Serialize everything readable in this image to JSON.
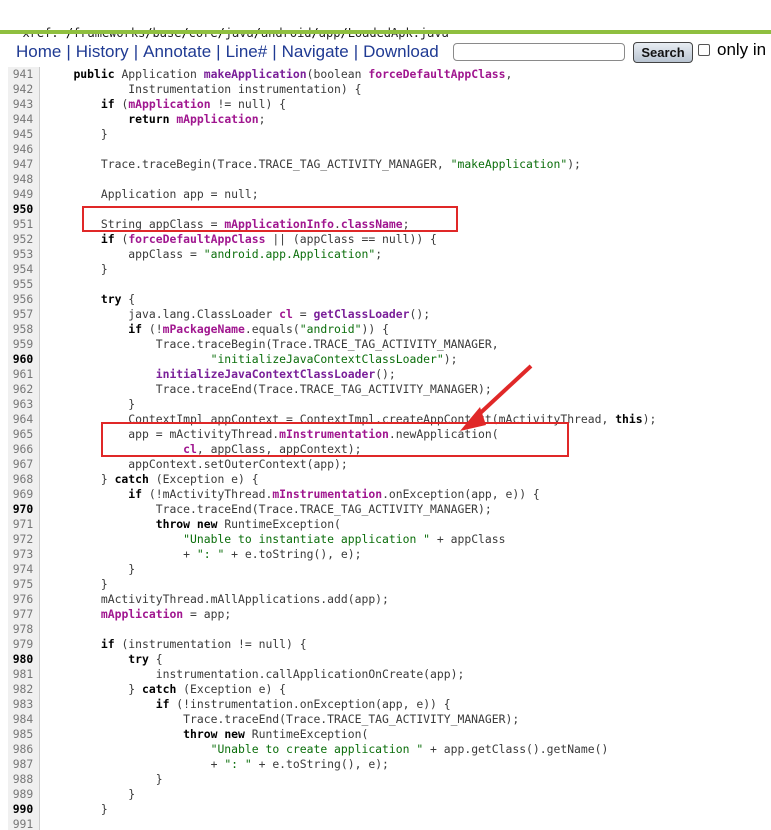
{
  "breadcrumb": {
    "prefix": "xref:",
    "parts": [
      "frameworks",
      "base",
      "core",
      "java",
      "android",
      "app",
      "LoadedApk.java"
    ]
  },
  "nav": {
    "items": [
      "Home",
      "History",
      "Annotate",
      "Line#",
      "Navigate",
      "Download"
    ]
  },
  "search": {
    "value": "",
    "button_label": "Search",
    "only_label": "only in"
  },
  "code": {
    "lines": [
      {
        "n": "941",
        "bold": false,
        "t": [
          [
            "    ",
            ""
          ],
          [
            "public",
            "kw"
          ],
          [
            " Application ",
            ""
          ],
          [
            "makeApplication",
            "fn"
          ],
          [
            "(boolean ",
            ""
          ],
          [
            "forceDefaultAppClass",
            "fld"
          ],
          [
            ",",
            ""
          ]
        ]
      },
      {
        "n": "942",
        "bold": false,
        "t": [
          [
            "            Instrumentation instrumentation) {",
            ""
          ]
        ]
      },
      {
        "n": "943",
        "bold": false,
        "t": [
          [
            "        ",
            ""
          ],
          [
            "if",
            "kw"
          ],
          [
            " (",
            ""
          ],
          [
            "mApplication",
            "fld"
          ],
          [
            " != null) {",
            ""
          ]
        ]
      },
      {
        "n": "944",
        "bold": false,
        "t": [
          [
            "            ",
            ""
          ],
          [
            "return",
            "kw"
          ],
          [
            " ",
            ""
          ],
          [
            "mApplication",
            "fld"
          ],
          [
            ";",
            ""
          ]
        ]
      },
      {
        "n": "945",
        "bold": false,
        "t": [
          [
            "        }",
            ""
          ]
        ]
      },
      {
        "n": "946",
        "bold": false,
        "t": [
          [
            "",
            ""
          ]
        ]
      },
      {
        "n": "947",
        "bold": false,
        "t": [
          [
            "        Trace.traceBegin(Trace.TRACE_TAG_ACTIVITY_MANAGER, ",
            ""
          ],
          [
            "\"makeApplication\"",
            "str"
          ],
          [
            ");",
            ""
          ]
        ]
      },
      {
        "n": "948",
        "bold": false,
        "t": [
          [
            "",
            ""
          ]
        ]
      },
      {
        "n": "949",
        "bold": false,
        "t": [
          [
            "        Application app = null;",
            ""
          ]
        ]
      },
      {
        "n": "950",
        "bold": true,
        "t": [
          [
            "",
            ""
          ]
        ]
      },
      {
        "n": "951",
        "bold": false,
        "t": [
          [
            "        String appClass = ",
            ""
          ],
          [
            "mApplicationInfo",
            "fld"
          ],
          [
            ".",
            ""
          ],
          [
            "className",
            "fld"
          ],
          [
            ";",
            ""
          ]
        ]
      },
      {
        "n": "952",
        "bold": false,
        "t": [
          [
            "        ",
            ""
          ],
          [
            "if",
            "kw"
          ],
          [
            " (",
            ""
          ],
          [
            "forceDefaultAppClass",
            "fld"
          ],
          [
            " || (appClass == null)) {",
            ""
          ]
        ]
      },
      {
        "n": "953",
        "bold": false,
        "t": [
          [
            "            appClass = ",
            ""
          ],
          [
            "\"android.app.Application\"",
            "str"
          ],
          [
            ";",
            ""
          ]
        ]
      },
      {
        "n": "954",
        "bold": false,
        "t": [
          [
            "        }",
            ""
          ]
        ]
      },
      {
        "n": "955",
        "bold": false,
        "t": [
          [
            "",
            ""
          ]
        ]
      },
      {
        "n": "956",
        "bold": false,
        "t": [
          [
            "        ",
            ""
          ],
          [
            "try",
            "kw"
          ],
          [
            " {",
            ""
          ]
        ]
      },
      {
        "n": "957",
        "bold": false,
        "t": [
          [
            "            java.lang.ClassLoader ",
            ""
          ],
          [
            "cl",
            "fld"
          ],
          [
            " = ",
            ""
          ],
          [
            "getClassLoader",
            "fn"
          ],
          [
            "();",
            ""
          ]
        ]
      },
      {
        "n": "958",
        "bold": false,
        "t": [
          [
            "            ",
            ""
          ],
          [
            "if",
            "kw"
          ],
          [
            " (!",
            ""
          ],
          [
            "mPackageName",
            "fld"
          ],
          [
            ".equals(",
            ""
          ],
          [
            "\"android\"",
            "str"
          ],
          [
            ")) {",
            ""
          ]
        ]
      },
      {
        "n": "959",
        "bold": false,
        "t": [
          [
            "                Trace.traceBegin(Trace.TRACE_TAG_ACTIVITY_MANAGER,",
            ""
          ]
        ]
      },
      {
        "n": "960",
        "bold": true,
        "t": [
          [
            "                        ",
            ""
          ],
          [
            "\"initializeJavaContextClassLoader\"",
            "str"
          ],
          [
            ");",
            ""
          ]
        ]
      },
      {
        "n": "961",
        "bold": false,
        "t": [
          [
            "                ",
            ""
          ],
          [
            "initializeJavaContextClassLoader",
            "fn"
          ],
          [
            "();",
            ""
          ]
        ]
      },
      {
        "n": "962",
        "bold": false,
        "t": [
          [
            "                Trace.traceEnd(Trace.TRACE_TAG_ACTIVITY_MANAGER);",
            ""
          ]
        ]
      },
      {
        "n": "963",
        "bold": false,
        "t": [
          [
            "            }",
            ""
          ]
        ]
      },
      {
        "n": "964",
        "bold": false,
        "t": [
          [
            "            ContextImpl appContext = ContextImpl.createAppContext(mActivityThread, ",
            ""
          ],
          [
            "this",
            "kw"
          ],
          [
            ");",
            ""
          ]
        ]
      },
      {
        "n": "965",
        "bold": false,
        "t": [
          [
            "            app = mActivityThread.",
            ""
          ],
          [
            "mInstrumentation",
            "fld"
          ],
          [
            ".newApplication(",
            ""
          ]
        ]
      },
      {
        "n": "966",
        "bold": false,
        "t": [
          [
            "                    ",
            ""
          ],
          [
            "cl",
            "fld"
          ],
          [
            ", appClass, appContext);",
            ""
          ]
        ]
      },
      {
        "n": "967",
        "bold": false,
        "t": [
          [
            "            appContext.setOuterContext(app);",
            ""
          ]
        ]
      },
      {
        "n": "968",
        "bold": false,
        "t": [
          [
            "        } ",
            ""
          ],
          [
            "catch",
            "kw"
          ],
          [
            " (Exception e) {",
            ""
          ]
        ]
      },
      {
        "n": "969",
        "bold": false,
        "t": [
          [
            "            ",
            ""
          ],
          [
            "if",
            "kw"
          ],
          [
            " (!mActivityThread.",
            ""
          ],
          [
            "mInstrumentation",
            "fld"
          ],
          [
            ".onException(app, e)) {",
            ""
          ]
        ]
      },
      {
        "n": "970",
        "bold": true,
        "t": [
          [
            "                Trace.traceEnd(Trace.TRACE_TAG_ACTIVITY_MANAGER);",
            ""
          ]
        ]
      },
      {
        "n": "971",
        "bold": false,
        "t": [
          [
            "                ",
            ""
          ],
          [
            "throw",
            "kw"
          ],
          [
            " ",
            ""
          ],
          [
            "new",
            "kw"
          ],
          [
            " RuntimeException(",
            ""
          ]
        ]
      },
      {
        "n": "972",
        "bold": false,
        "t": [
          [
            "                    ",
            ""
          ],
          [
            "\"Unable to instantiate application \"",
            "str"
          ],
          [
            " + appClass",
            ""
          ]
        ]
      },
      {
        "n": "973",
        "bold": false,
        "t": [
          [
            "                    + ",
            ""
          ],
          [
            "\": \"",
            "str"
          ],
          [
            " + e.toString(), e);",
            ""
          ]
        ]
      },
      {
        "n": "974",
        "bold": false,
        "t": [
          [
            "            }",
            ""
          ]
        ]
      },
      {
        "n": "975",
        "bold": false,
        "t": [
          [
            "        }",
            ""
          ]
        ]
      },
      {
        "n": "976",
        "bold": false,
        "t": [
          [
            "        mActivityThread.mAllApplications.add(app);",
            ""
          ]
        ]
      },
      {
        "n": "977",
        "bold": false,
        "t": [
          [
            "        ",
            ""
          ],
          [
            "mApplication",
            "fld"
          ],
          [
            " = app;",
            ""
          ]
        ]
      },
      {
        "n": "978",
        "bold": false,
        "t": [
          [
            "",
            ""
          ]
        ]
      },
      {
        "n": "979",
        "bold": false,
        "t": [
          [
            "        ",
            ""
          ],
          [
            "if",
            "kw"
          ],
          [
            " (instrumentation != null) {",
            ""
          ]
        ]
      },
      {
        "n": "980",
        "bold": true,
        "t": [
          [
            "            ",
            ""
          ],
          [
            "try",
            "kw"
          ],
          [
            " {",
            ""
          ]
        ]
      },
      {
        "n": "981",
        "bold": false,
        "t": [
          [
            "                instrumentation.callApplicationOnCreate(app);",
            ""
          ]
        ]
      },
      {
        "n": "982",
        "bold": false,
        "t": [
          [
            "            } ",
            ""
          ],
          [
            "catch",
            "kw"
          ],
          [
            " (Exception e) {",
            ""
          ]
        ]
      },
      {
        "n": "983",
        "bold": false,
        "t": [
          [
            "                ",
            ""
          ],
          [
            "if",
            "kw"
          ],
          [
            " (!instrumentation.onException(app, e)) {",
            ""
          ]
        ]
      },
      {
        "n": "984",
        "bold": false,
        "t": [
          [
            "                    Trace.traceEnd(Trace.TRACE_TAG_ACTIVITY_MANAGER);",
            ""
          ]
        ]
      },
      {
        "n": "985",
        "bold": false,
        "t": [
          [
            "                    ",
            ""
          ],
          [
            "throw",
            "kw"
          ],
          [
            " ",
            ""
          ],
          [
            "new",
            "kw"
          ],
          [
            " RuntimeException(",
            ""
          ]
        ]
      },
      {
        "n": "986",
        "bold": false,
        "t": [
          [
            "                        ",
            ""
          ],
          [
            "\"Unable to create application \"",
            "str"
          ],
          [
            " + app.getClass().getName()",
            ""
          ]
        ]
      },
      {
        "n": "987",
        "bold": false,
        "t": [
          [
            "                        + ",
            ""
          ],
          [
            "\": \"",
            "str"
          ],
          [
            " + e.toString(), e);",
            ""
          ]
        ]
      },
      {
        "n": "988",
        "bold": false,
        "t": [
          [
            "                }",
            ""
          ]
        ]
      },
      {
        "n": "989",
        "bold": false,
        "t": [
          [
            "            }",
            ""
          ]
        ]
      },
      {
        "n": "990",
        "bold": true,
        "t": [
          [
            "        }",
            ""
          ]
        ]
      },
      {
        "n": "991",
        "bold": false,
        "t": [
          [
            "",
            ""
          ]
        ]
      }
    ]
  },
  "annotations": {
    "highlight_color": "#e02828",
    "arrow_color": "#e02828"
  }
}
